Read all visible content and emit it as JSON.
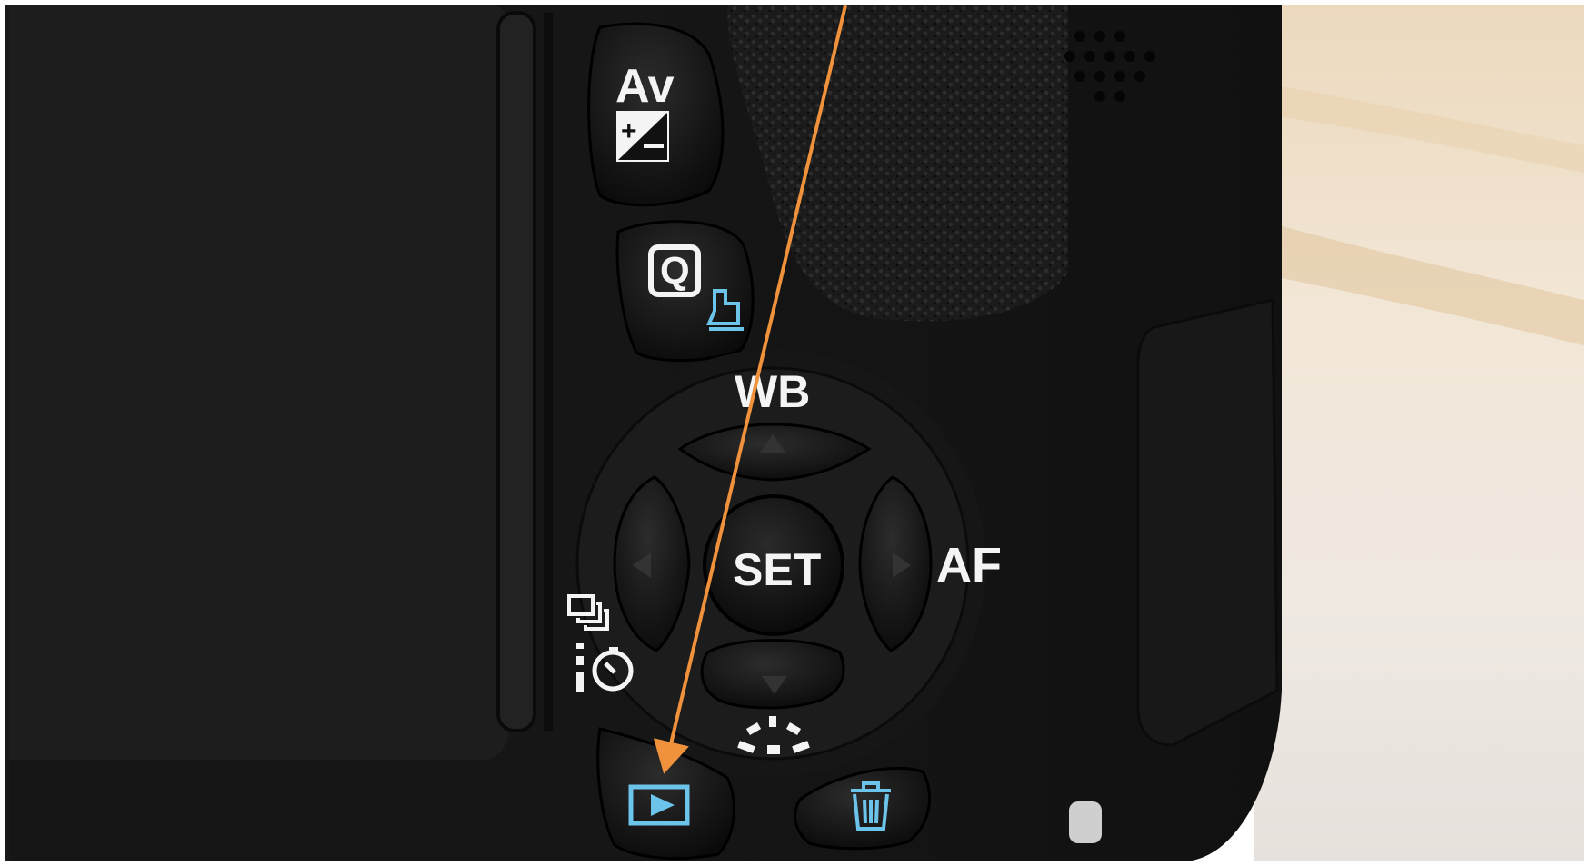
{
  "camera": {
    "buttons": {
      "av_label": "Av",
      "q_label": "Q",
      "set_label": "SET"
    },
    "dial_labels": {
      "up": "WB",
      "right": "AF"
    }
  },
  "annotation": {
    "arrow_color": "#f0913c",
    "points_to": "playback-button"
  },
  "colors": {
    "body": "#141414",
    "highlight_blue": "#6cc4ea",
    "background_right": "#e9dccb",
    "white_label": "#f4f4f4"
  }
}
